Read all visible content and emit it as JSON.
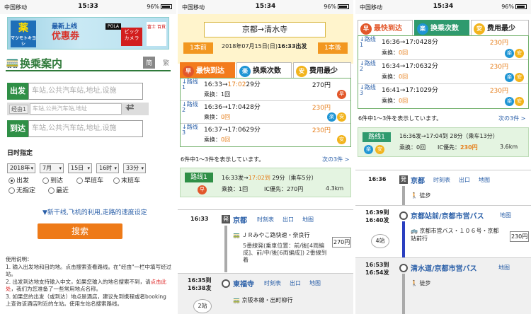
{
  "status": {
    "carrier": "中国移动",
    "battery": "96%",
    "times": [
      "15:33",
      "15:34",
      "15:34"
    ]
  },
  "p1": {
    "ad": {
      "logo": "薬",
      "logo_sub": "マツモトキヨシ",
      "line1": "最新上线",
      "line2": "优惠劵",
      "pola": "POLA",
      "bic": "ビック カメラ",
      "fuji": "富士 百貨"
    },
    "title": "换乘案内",
    "lang_jp": "简",
    "lang_tw": "繁",
    "from_label": "出发",
    "from_ph": "车站,公共汽车站,地址,设施",
    "via_label": "经由1",
    "via_ph": "车站,公共汽车站,地址",
    "to_label": "到达",
    "to_ph": "车站,公共汽车站,地址,设施",
    "date_title": "日时指定",
    "selects": [
      "2018年",
      "7月",
      "15日",
      "16时",
      "33分"
    ],
    "radios": [
      "出发",
      "到达",
      "早班车",
      "末班车",
      "无指定",
      "最近"
    ],
    "options_link": "▼新干线,飞机的利用,走路的速度设定",
    "search": "搜索",
    "notes": [
      "使用说明：",
      "1. 输入出发地和目的地。点击搜索查看路线。在\"经由\"一栏中填写经过站。",
      "2. 出发到达地支持输入中文，如果您输入的地名搜索不到，请",
      "点击此处",
      "，我们为您准备了一些常用地点名称。",
      "3. 如果您的出发（或到达）地点是酒店，建议先到携程或者booking上查询该酒店附近的车站。使用车站名搜索路线。"
    ]
  },
  "p2": {
    "route": "京都→清水寺",
    "date": "2018年07月15日(日)",
    "date_b": "16:33出发",
    "prev": "1本前",
    "next": "1本後",
    "tabs": [
      "最快到达",
      "换乘次数",
      "费用最少"
    ],
    "tab_icons": [
      "早",
      "楽",
      "安"
    ],
    "rows": [
      {
        "num": "路线\n1",
        "dep": "16:33",
        "arr": "17:02",
        "dur": "29分",
        "fare": "270円",
        "transfers": "1回"
      },
      {
        "num": "路线\n2",
        "dep": "16:36",
        "arr": "17:04",
        "dur": "28分",
        "fare": "230円",
        "transfers": "0回"
      },
      {
        "num": "路线\n3",
        "dep": "16:37",
        "arr": "17:06",
        "dur": "29分",
        "fare": "230円",
        "transfers": "0回"
      }
    ],
    "arrow": "→",
    "transfer_label": "乘换：",
    "count": "6件中1～3件を表示しています。",
    "next3": "次の3件 >",
    "detail": {
      "label": "路线1",
      "time": "16:33发→",
      "arr": "17:02到",
      "dur": "29分（乘车5分）",
      "transfers": "乘换：1回",
      "ic": "IC優先：270円",
      "dist": "4.3km"
    },
    "steps": [
      {
        "time": "16:33",
        "station": "京都",
        "links": [
          "时刻表",
          "出口",
          "地图"
        ]
      },
      {
        "time": "16:35到\n16:38发",
        "station": "東福寺",
        "links": [
          "时刻表",
          "出口",
          "地图"
        ]
      }
    ],
    "line1_name": "ＪＲみやこ路快速・奈良行",
    "line1_info": "5番線発(乗車位置：前/後[4両編成]、前/中/後[6両編成])",
    "line1_info2": "2番線到着",
    "fare_box": "270円",
    "line2_name": "京阪本線・出町柳行",
    "stops": "2站"
  },
  "p3": {
    "tabs": [
      "最快到达",
      "换乘次数",
      "费用最少"
    ],
    "tab_icons": [
      "早",
      "楽",
      "安"
    ],
    "rows": [
      {
        "num": "路线\n1",
        "time": "16:36→17:04",
        "dur": "28分",
        "fare": "230円",
        "transfers": "0回"
      },
      {
        "num": "路线\n2",
        "time": "16:34→17:06",
        "dur": "32分",
        "fare": "230円",
        "transfers": "0回"
      },
      {
        "num": "路线\n3",
        "time": "16:41→17:10",
        "dur": "29分",
        "fare": "230円",
        "transfers": "0回"
      }
    ],
    "count": "6件中1～3件を表示しています。",
    "next3": "次の3件 >",
    "detail": {
      "label": "路线1",
      "time": "16:36发→17:04到 28分（乘车13分）",
      "transfers": "乘换：0回",
      "ic": "IC優先：",
      "fare": "230円",
      "dist": "3.6km"
    },
    "steps": [
      {
        "time": "16:36",
        "station": "京都",
        "links": [
          "时刻表",
          "出口",
          "地图"
        ]
      },
      {
        "time": "16:39到\n16:40发",
        "station": "京都站前/京都市営バス",
        "links": [
          "地图"
        ]
      },
      {
        "time": "16:53到\n16:54发",
        "station": "清水道/京都市営バス",
        "links": [
          "地图"
        ]
      }
    ],
    "walk": "徒步",
    "bus": "京都市営バス・１０６号・京都站前行",
    "fare_box": "230円",
    "stops": "4站",
    "walk2": "徒步"
  }
}
